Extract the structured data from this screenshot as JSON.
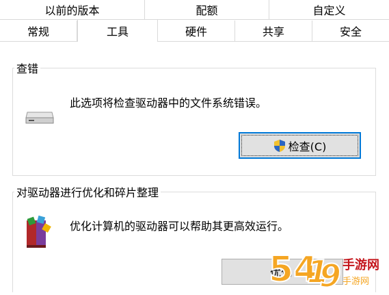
{
  "tabs_top": [
    "以前的版本",
    "配额",
    "自定义"
  ],
  "tabs_bottom": [
    "常规",
    "工具",
    "硬件",
    "共享",
    "安全"
  ],
  "error_check": {
    "title": "查错",
    "description": "此选项将检查驱动器中的文件系统错误。",
    "button_label": "检查(C)"
  },
  "optimize": {
    "title": "对驱动器进行优化和碎片整理",
    "description": "优化计算机的驱动器可以帮助其更高效运行。",
    "button_label": "优化"
  },
  "watermark": {
    "text": "54119手游网",
    "sub": "手游网"
  },
  "colors": {
    "focus_border": "#0078d7",
    "button_bg": "#e1e1e1",
    "watermark": "#f5a623"
  }
}
